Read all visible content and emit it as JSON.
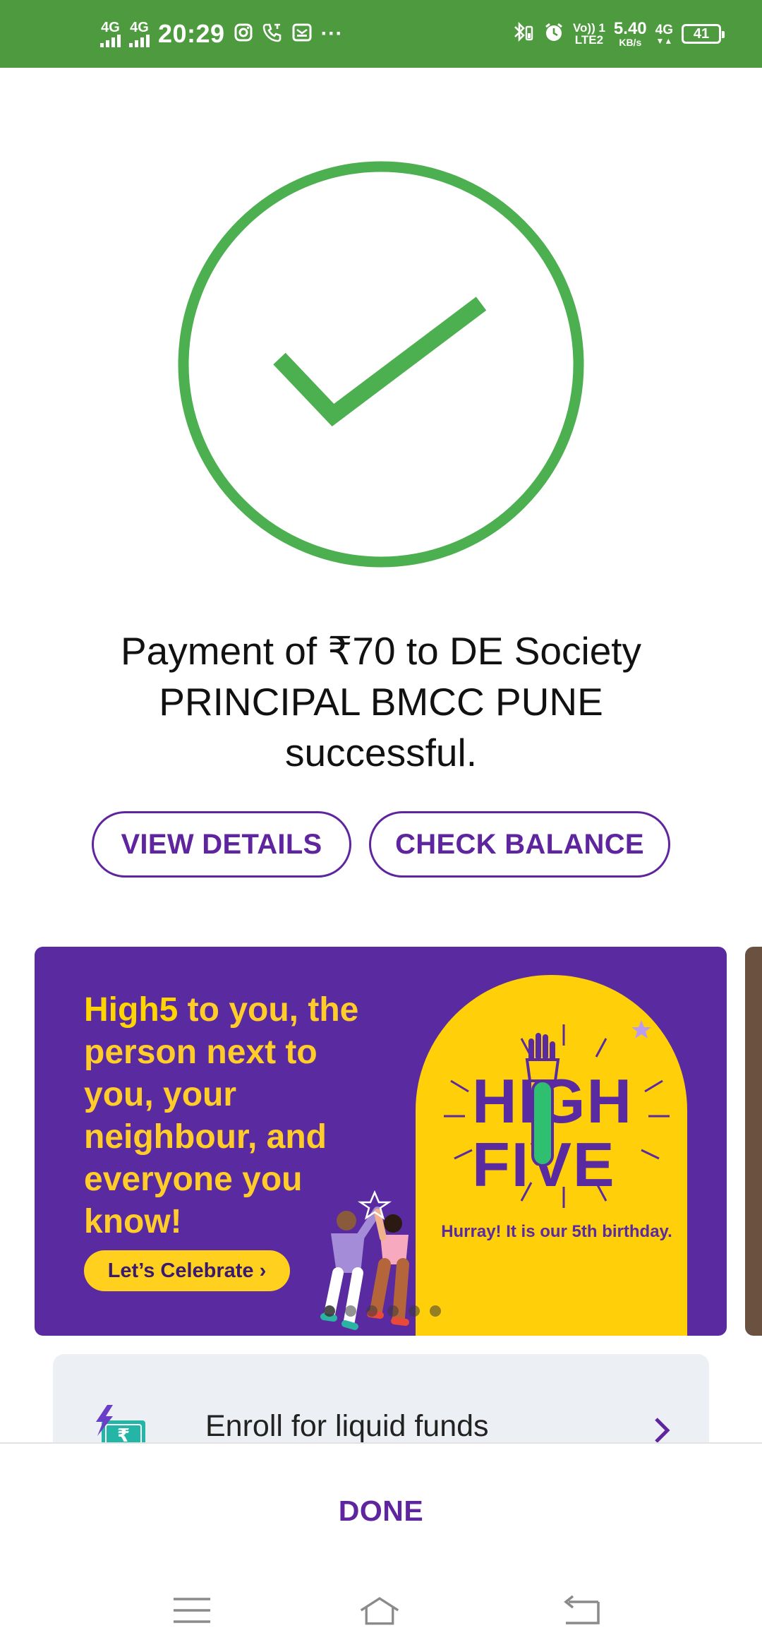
{
  "status_bar": {
    "signal1": "4G",
    "signal2": "4G",
    "time": "20:29",
    "more": "···",
    "volte": "Vo)) 1",
    "lte": "LTE2",
    "speed_value": "5.40",
    "speed_unit": "KB/s",
    "network2": "4G",
    "battery": "41",
    "bg_color": "#4e9a3e"
  },
  "success": {
    "icon": "check-circle-icon",
    "color": "#4caf50",
    "message": "Payment of ₹70 to DE Society PRINCIPAL BMCC PUNE successful."
  },
  "actions": {
    "view_details": "VIEW DETAILS",
    "check_balance": "CHECK BALANCE"
  },
  "banner": {
    "headline_highlight": "High5",
    "headline_rest": " to you, the person next to you, your neighbour, and everyone you know!",
    "cta": "Let’s Celebrate ›",
    "word1": "HIGH",
    "word2": "FIVE",
    "tagline": "Hurray! It is our 5th birthday.",
    "bg_color": "#5a2aa0",
    "accent_color": "#ffd00a"
  },
  "fund_card": {
    "label": "Enroll for liquid funds",
    "icon": "rupee-card-icon"
  },
  "footer": {
    "done": "DONE"
  },
  "brand_color": "#5f259f"
}
